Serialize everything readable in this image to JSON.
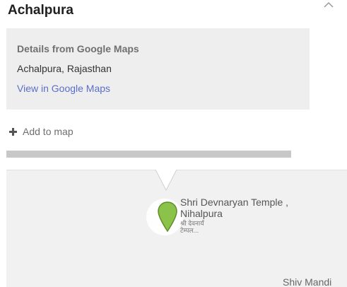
{
  "title": "Achalpura",
  "icons": {
    "close": "chevron-up-icon",
    "add": "plus-icon",
    "pin": "map-pin-icon"
  },
  "details": {
    "heading": "Details from Google Maps",
    "address": "Achalpura, Rajasthan",
    "link": "View in Google Maps"
  },
  "add_to_map": "Add to map",
  "map": {
    "poi_name": "Shri Devnaryan Temple , Nihalpura",
    "poi_local": "श्री देवनार्यं टेम्पल...",
    "label_2": "Shiv Mandi",
    "pin_color": "#8bc34a"
  }
}
